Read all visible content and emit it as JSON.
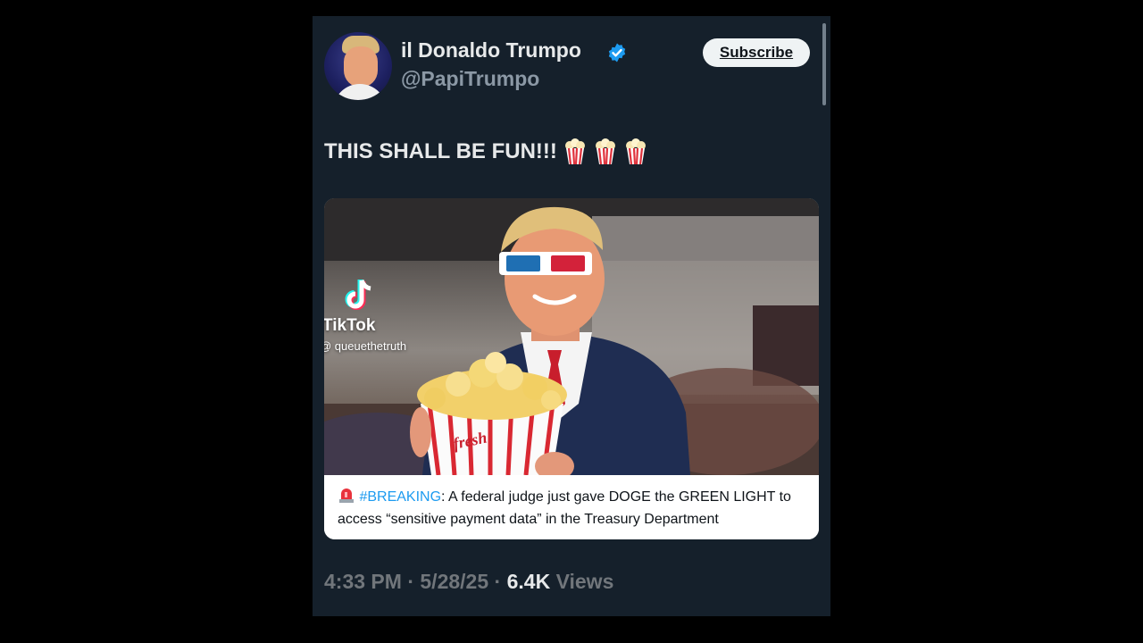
{
  "author": {
    "display_name": "il Donaldo Trumpo",
    "handle": "@PapiTrumpo",
    "verified": true
  },
  "subscribe_label": "Subscribe",
  "tweet": {
    "text": "THIS SHALL BE FUN!!!",
    "emoji": [
      "popcorn-icon",
      "popcorn-icon",
      "popcorn-icon"
    ]
  },
  "media": {
    "watermark_brand": "TikTok",
    "watermark_handle": "@ queuethetruth",
    "popcorn_box_text": "fresh POP",
    "caption_emoji": "siren-icon",
    "caption_hashtag": "#BREAKING",
    "caption_text": ": A federal judge just gave DOGE the GREEN LIGHT to access “sensitive payment data” in the Treasury Department"
  },
  "meta": {
    "time": "4:33 PM",
    "date": "5/28/25",
    "views_count": "6.4K",
    "views_label": "Views",
    "separator": "·"
  },
  "colors": {
    "background": "#15202b",
    "accent": "#1d9bf0",
    "text_primary": "#e7e9ea",
    "text_secondary": "#8b98a5"
  }
}
